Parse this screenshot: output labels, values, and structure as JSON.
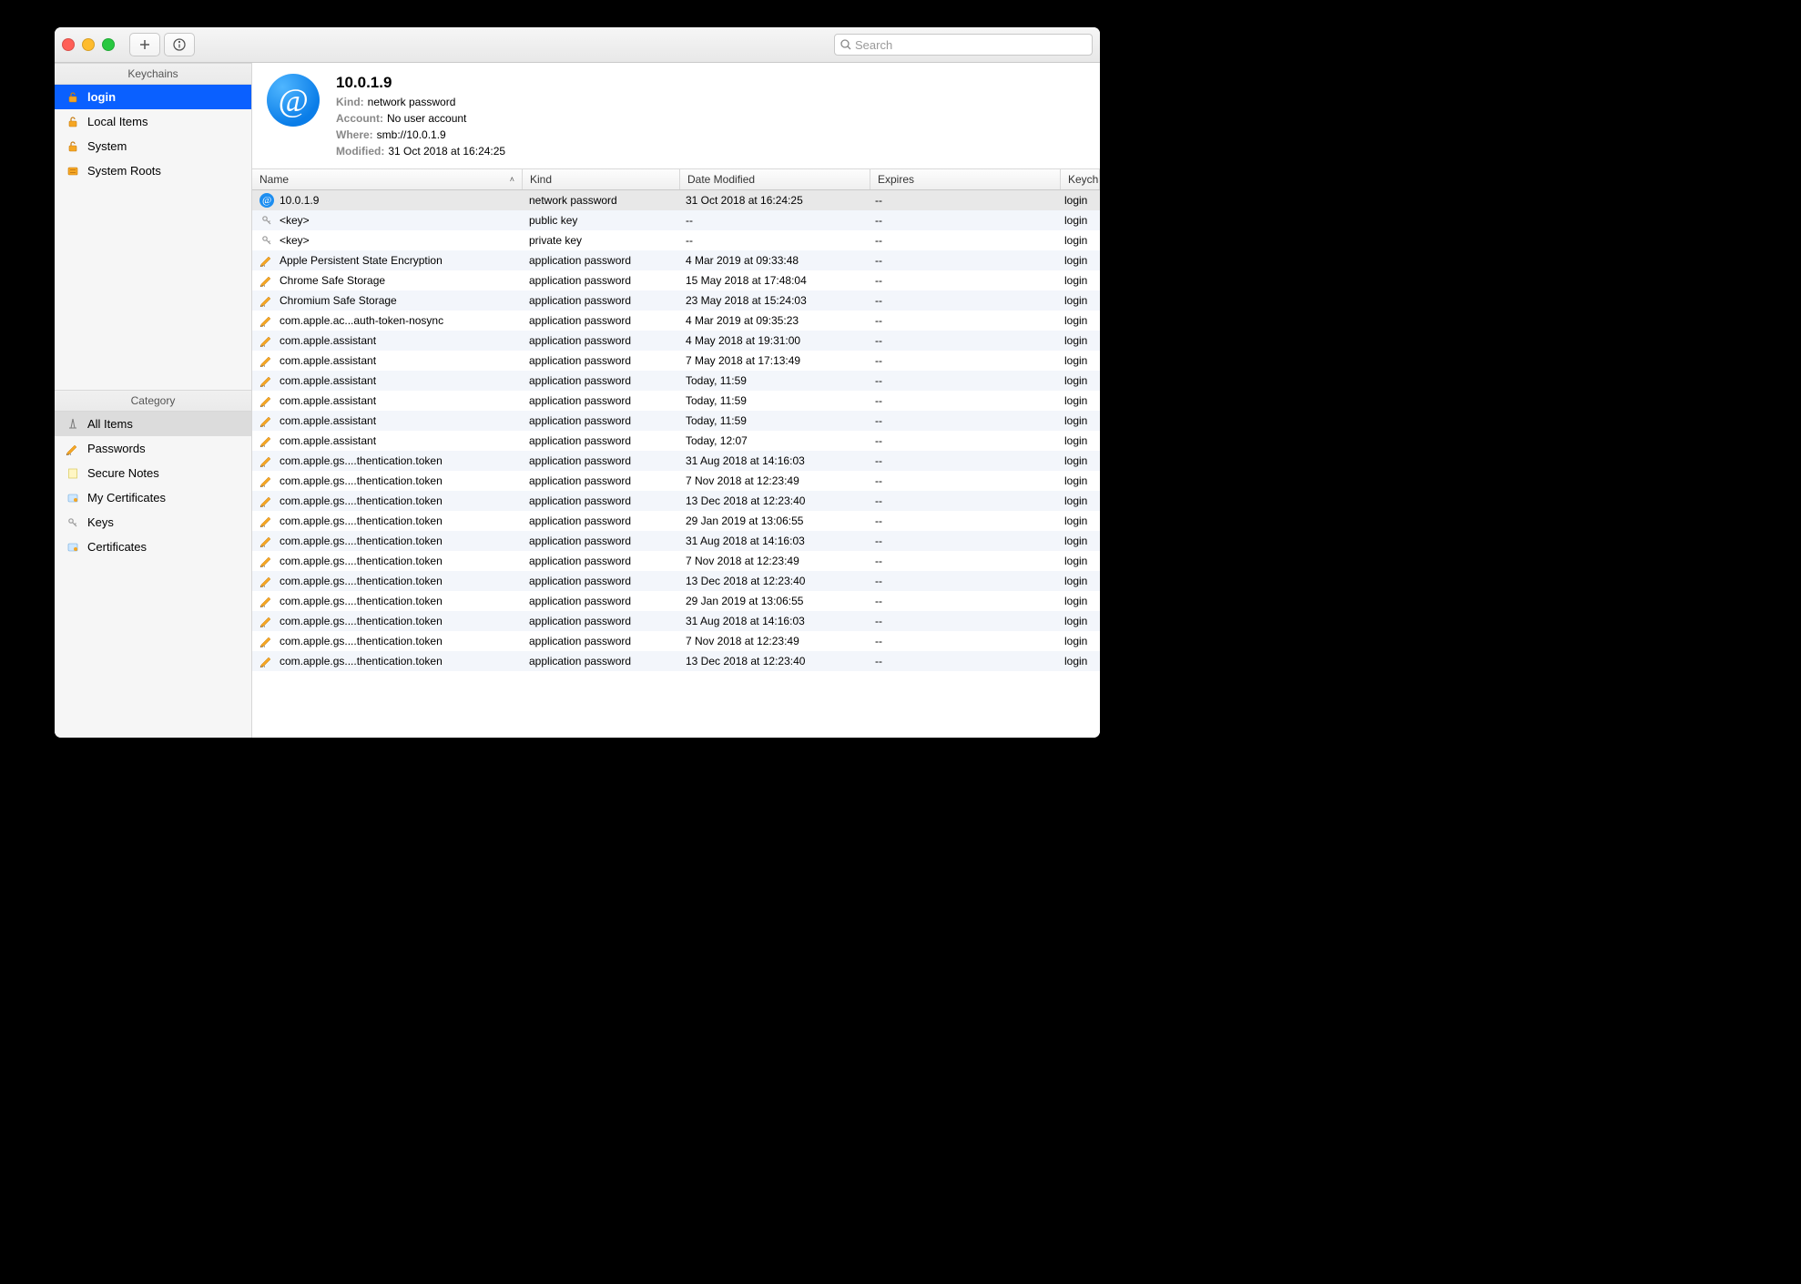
{
  "toolbar": {
    "search_placeholder": "Search"
  },
  "sidebar": {
    "keychains_title": "Keychains",
    "category_title": "Category",
    "keychains": [
      {
        "label": "login",
        "icon": "lock-open",
        "active": true
      },
      {
        "label": "Local Items",
        "icon": "lock-open"
      },
      {
        "label": "System",
        "icon": "lock-open"
      },
      {
        "label": "System Roots",
        "icon": "drawer"
      }
    ],
    "categories": [
      {
        "label": "All Items",
        "icon": "compass",
        "active": true
      },
      {
        "label": "Passwords",
        "icon": "pencil"
      },
      {
        "label": "Secure Notes",
        "icon": "note"
      },
      {
        "label": "My Certificates",
        "icon": "cert"
      },
      {
        "label": "Keys",
        "icon": "key"
      },
      {
        "label": "Certificates",
        "icon": "cert"
      }
    ]
  },
  "detail": {
    "title": "10.0.1.9",
    "rows": [
      {
        "lbl": "Kind:",
        "val": "network password"
      },
      {
        "lbl": "Account:",
        "val": "No user account"
      },
      {
        "lbl": "Where:",
        "val": "smb://10.0.1.9"
      },
      {
        "lbl": "Modified:",
        "val": "31 Oct 2018 at 16:24:25"
      }
    ]
  },
  "columns": [
    {
      "label": "Name",
      "sort": "asc"
    },
    {
      "label": "Kind"
    },
    {
      "label": "Date Modified"
    },
    {
      "label": "Expires"
    },
    {
      "label": "Keychain"
    }
  ],
  "rows": [
    {
      "icon": "at",
      "name": "10.0.1.9",
      "kind": "network password",
      "modified": "31 Oct 2018 at 16:24:25",
      "expires": "--",
      "keychain": "login",
      "selected": true
    },
    {
      "icon": "key",
      "name": "<key>",
      "kind": "public key",
      "modified": "--",
      "expires": "--",
      "keychain": "login"
    },
    {
      "icon": "key",
      "name": "<key>",
      "kind": "private key",
      "modified": "--",
      "expires": "--",
      "keychain": "login"
    },
    {
      "icon": "pencil",
      "name": "Apple Persistent State Encryption",
      "kind": "application password",
      "modified": "4 Mar 2019 at 09:33:48",
      "expires": "--",
      "keychain": "login"
    },
    {
      "icon": "pencil",
      "name": "Chrome Safe Storage",
      "kind": "application password",
      "modified": "15 May 2018 at 17:48:04",
      "expires": "--",
      "keychain": "login"
    },
    {
      "icon": "pencil",
      "name": "Chromium Safe Storage",
      "kind": "application password",
      "modified": "23 May 2018 at 15:24:03",
      "expires": "--",
      "keychain": "login"
    },
    {
      "icon": "pencil",
      "name": "com.apple.ac...auth-token-nosync",
      "kind": "application password",
      "modified": "4 Mar 2019 at 09:35:23",
      "expires": "--",
      "keychain": "login"
    },
    {
      "icon": "pencil",
      "name": "com.apple.assistant",
      "kind": "application password",
      "modified": "4 May 2018 at 19:31:00",
      "expires": "--",
      "keychain": "login"
    },
    {
      "icon": "pencil",
      "name": "com.apple.assistant",
      "kind": "application password",
      "modified": "7 May 2018 at 17:13:49",
      "expires": "--",
      "keychain": "login"
    },
    {
      "icon": "pencil",
      "name": "com.apple.assistant",
      "kind": "application password",
      "modified": "Today, 11:59",
      "expires": "--",
      "keychain": "login"
    },
    {
      "icon": "pencil",
      "name": "com.apple.assistant",
      "kind": "application password",
      "modified": "Today, 11:59",
      "expires": "--",
      "keychain": "login"
    },
    {
      "icon": "pencil",
      "name": "com.apple.assistant",
      "kind": "application password",
      "modified": "Today, 11:59",
      "expires": "--",
      "keychain": "login"
    },
    {
      "icon": "pencil",
      "name": "com.apple.assistant",
      "kind": "application password",
      "modified": "Today, 12:07",
      "expires": "--",
      "keychain": "login"
    },
    {
      "icon": "pencil",
      "name": "com.apple.gs....thentication.token",
      "kind": "application password",
      "modified": "31 Aug 2018 at 14:16:03",
      "expires": "--",
      "keychain": "login"
    },
    {
      "icon": "pencil",
      "name": "com.apple.gs....thentication.token",
      "kind": "application password",
      "modified": "7 Nov 2018 at 12:23:49",
      "expires": "--",
      "keychain": "login"
    },
    {
      "icon": "pencil",
      "name": "com.apple.gs....thentication.token",
      "kind": "application password",
      "modified": "13 Dec 2018 at 12:23:40",
      "expires": "--",
      "keychain": "login"
    },
    {
      "icon": "pencil",
      "name": "com.apple.gs....thentication.token",
      "kind": "application password",
      "modified": "29 Jan 2019 at 13:06:55",
      "expires": "--",
      "keychain": "login"
    },
    {
      "icon": "pencil",
      "name": "com.apple.gs....thentication.token",
      "kind": "application password",
      "modified": "31 Aug 2018 at 14:16:03",
      "expires": "--",
      "keychain": "login"
    },
    {
      "icon": "pencil",
      "name": "com.apple.gs....thentication.token",
      "kind": "application password",
      "modified": "7 Nov 2018 at 12:23:49",
      "expires": "--",
      "keychain": "login"
    },
    {
      "icon": "pencil",
      "name": "com.apple.gs....thentication.token",
      "kind": "application password",
      "modified": "13 Dec 2018 at 12:23:40",
      "expires": "--",
      "keychain": "login"
    },
    {
      "icon": "pencil",
      "name": "com.apple.gs....thentication.token",
      "kind": "application password",
      "modified": "29 Jan 2019 at 13:06:55",
      "expires": "--",
      "keychain": "login"
    },
    {
      "icon": "pencil",
      "name": "com.apple.gs....thentication.token",
      "kind": "application password",
      "modified": "31 Aug 2018 at 14:16:03",
      "expires": "--",
      "keychain": "login"
    },
    {
      "icon": "pencil",
      "name": "com.apple.gs....thentication.token",
      "kind": "application password",
      "modified": "7 Nov 2018 at 12:23:49",
      "expires": "--",
      "keychain": "login"
    },
    {
      "icon": "pencil",
      "name": "com.apple.gs....thentication.token",
      "kind": "application password",
      "modified": "13 Dec 2018 at 12:23:40",
      "expires": "--",
      "keychain": "login"
    }
  ]
}
